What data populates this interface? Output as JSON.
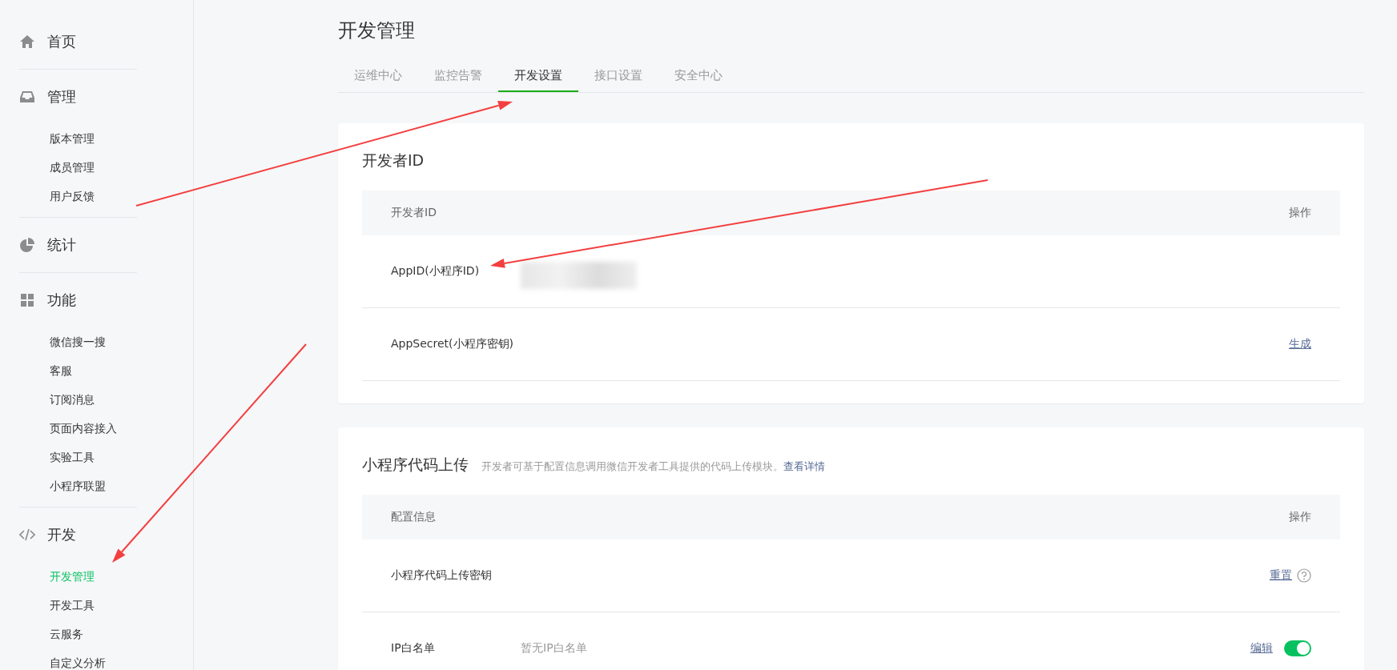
{
  "sidebar": {
    "groups": [
      {
        "label": "首页"
      },
      {
        "label": "管理",
        "children": [
          {
            "label": "版本管理",
            "selected": false
          },
          {
            "label": "成员管理",
            "selected": false
          },
          {
            "label": "用户反馈",
            "selected": false
          }
        ]
      },
      {
        "label": "统计"
      },
      {
        "label": "功能",
        "children": [
          {
            "label": "微信搜一搜",
            "selected": false
          },
          {
            "label": "客服",
            "selected": false
          },
          {
            "label": "订阅消息",
            "selected": false
          },
          {
            "label": "页面内容接入",
            "selected": false
          },
          {
            "label": "实验工具",
            "selected": false
          },
          {
            "label": "小程序联盟",
            "selected": false
          }
        ]
      },
      {
        "label": "开发",
        "children": [
          {
            "label": "开发管理",
            "selected": true
          },
          {
            "label": "开发工具",
            "selected": false
          },
          {
            "label": "云服务",
            "selected": false
          },
          {
            "label": "自定义分析",
            "selected": false
          }
        ]
      }
    ]
  },
  "page_title": "开发管理",
  "tabs": [
    {
      "label": "运维中心",
      "selected": false
    },
    {
      "label": "监控告警",
      "selected": false
    },
    {
      "label": "开发设置",
      "selected": true
    },
    {
      "label": "接口设置",
      "selected": false
    },
    {
      "label": "安全中心",
      "selected": false
    }
  ],
  "cards": [
    {
      "title": "开发者ID",
      "columns": [
        "开发者ID",
        "操作"
      ],
      "rows": [
        {
          "label": "AppID(小程序ID)",
          "redacted": true
        },
        {
          "label": "AppSecret(小程序密钥)",
          "action": "生成"
        }
      ]
    },
    {
      "title": "小程序代码上传",
      "description": "开发者可基于配置信息调用微信开发者工具提供的代码上传模块。",
      "link": "查看详情",
      "columns": [
        "配置信息",
        "操作"
      ],
      "rows": [
        {
          "label": "小程序代码上传密钥",
          "action": "重置",
          "kind": "help"
        },
        {
          "label": "IP白名单",
          "value": "暂无IP白名单",
          "action": "编辑",
          "kind": "toggle",
          "on": true
        }
      ]
    }
  ]
}
